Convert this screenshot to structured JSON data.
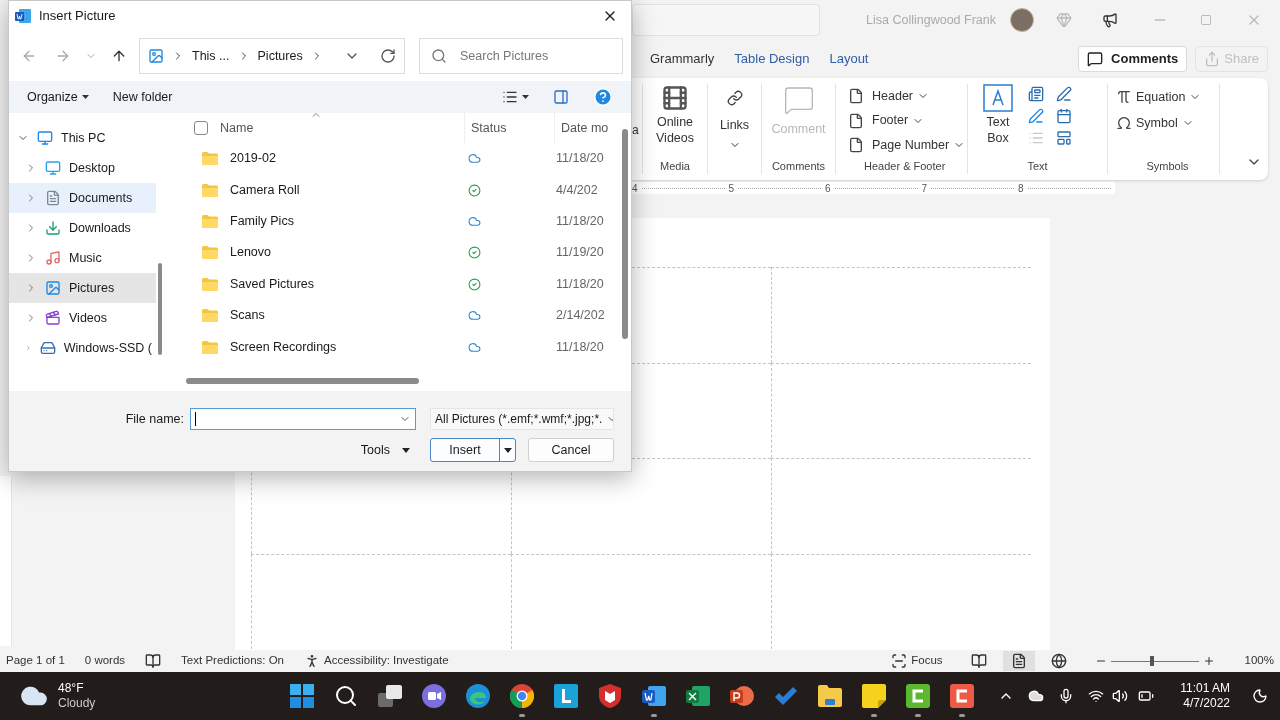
{
  "word": {
    "account_name": "Lisa Collingwood Frank",
    "tabs": [
      {
        "label": "Grammarly",
        "kind": "normal"
      },
      {
        "label": "Table Design",
        "kind": "contextual"
      },
      {
        "label": "Layout",
        "kind": "contextual"
      }
    ],
    "comments_button": "Comments",
    "share_button": {
      "label": "Share",
      "disabled": true
    },
    "ribbon": {
      "cut_label": "a",
      "media": {
        "button": "Online Videos",
        "group": "Media"
      },
      "links": {
        "button": "Links"
      },
      "comments": {
        "button": "Comment",
        "disabled": true,
        "group": "Comments"
      },
      "header_footer": {
        "items": [
          "Header",
          "Footer",
          "Page Number"
        ],
        "group": "Header & Footer"
      },
      "text": {
        "button": "Text Box",
        "group": "Text"
      },
      "symbols": {
        "items": [
          "Equation",
          "Symbol"
        ],
        "group": "Symbols"
      }
    },
    "ruler_numbers": [
      "4",
      "5",
      "6",
      "7",
      "8"
    ],
    "status_bar": {
      "page": "Page 1 of 1",
      "words": "0 words",
      "predictions": "Text Predictions: On",
      "accessibility": "Accessibility: Investigate",
      "focus": "Focus",
      "views": [
        {
          "kind": "read",
          "selected": false
        },
        {
          "kind": "print",
          "selected": true
        },
        {
          "kind": "web",
          "selected": false
        }
      ],
      "zoom": {
        "level": 0.47,
        "label": "100%"
      }
    }
  },
  "dialog": {
    "title": "Insert Picture",
    "breadcrumb": [
      "This ...",
      "Pictures"
    ],
    "search": {
      "placeholder": "Search Pictures"
    },
    "toolbar": [
      "Organize",
      "New folder"
    ],
    "tree": [
      {
        "label": "This PC",
        "kind": "pc",
        "expanded": true,
        "children": [
          {
            "label": "Desktop",
            "kind": "desktop",
            "selected": false,
            "hovered": false
          },
          {
            "label": "Documents",
            "kind": "documents",
            "selected": false,
            "hovered": true
          },
          {
            "label": "Downloads",
            "kind": "downloads",
            "selected": false,
            "hovered": false
          },
          {
            "label": "Music",
            "kind": "music",
            "selected": false,
            "hovered": false
          },
          {
            "label": "Pictures",
            "kind": "pictures",
            "selected": true,
            "hovered": false
          },
          {
            "label": "Videos",
            "kind": "videos",
            "selected": false,
            "hovered": false
          },
          {
            "label": "Windows-SSD (",
            "kind": "drive",
            "selected": false,
            "hovered": false
          }
        ]
      }
    ],
    "columns": [
      "Name",
      "Status",
      "Date mo"
    ],
    "select_all_checked": false,
    "rows": [
      {
        "name": "2019-02",
        "kind": "cloud",
        "date": "11/18/20"
      },
      {
        "name": "Camera Roll",
        "kind": "available",
        "date": "4/4/202"
      },
      {
        "name": "Family Pics",
        "kind": "cloud",
        "date": "11/18/20"
      },
      {
        "name": "Lenovo",
        "kind": "available",
        "date": "11/19/20"
      },
      {
        "name": "Saved Pictures",
        "kind": "available",
        "date": "11/18/20"
      },
      {
        "name": "Scans",
        "kind": "cloud",
        "date": "2/14/202"
      },
      {
        "name": "Screen Recordings",
        "kind": "cloud",
        "date": "11/18/20"
      }
    ],
    "file_name_label": "File name:",
    "filter": "All Pictures (*.emf;*.wmf;*.jpg;*.",
    "buttons": {
      "tools": "Tools",
      "insert": "Insert",
      "cancel": "Cancel"
    }
  },
  "taskbar": {
    "weather": {
      "temp": "48°F",
      "condition": "Cloudy"
    },
    "apps": [
      {
        "kind": "start",
        "running": false
      },
      {
        "kind": "search",
        "running": false
      },
      {
        "kind": "taskview",
        "running": false
      },
      {
        "kind": "teams",
        "running": false
      },
      {
        "kind": "edge",
        "running": false
      },
      {
        "kind": "chrome",
        "running": true
      },
      {
        "kind": "lync",
        "running": false
      },
      {
        "kind": "mcafee",
        "running": false
      },
      {
        "kind": "word",
        "running": true
      },
      {
        "kind": "excel",
        "running": false
      },
      {
        "kind": "powerpoint",
        "running": false
      },
      {
        "kind": "todo",
        "running": false
      },
      {
        "kind": "explorer",
        "running": false
      },
      {
        "kind": "sticky",
        "running": true
      },
      {
        "kind": "camtasia",
        "running": true
      },
      {
        "kind": "recorder",
        "running": true
      }
    ],
    "time": "11:01 AM",
    "date": "4/7/2022"
  }
}
